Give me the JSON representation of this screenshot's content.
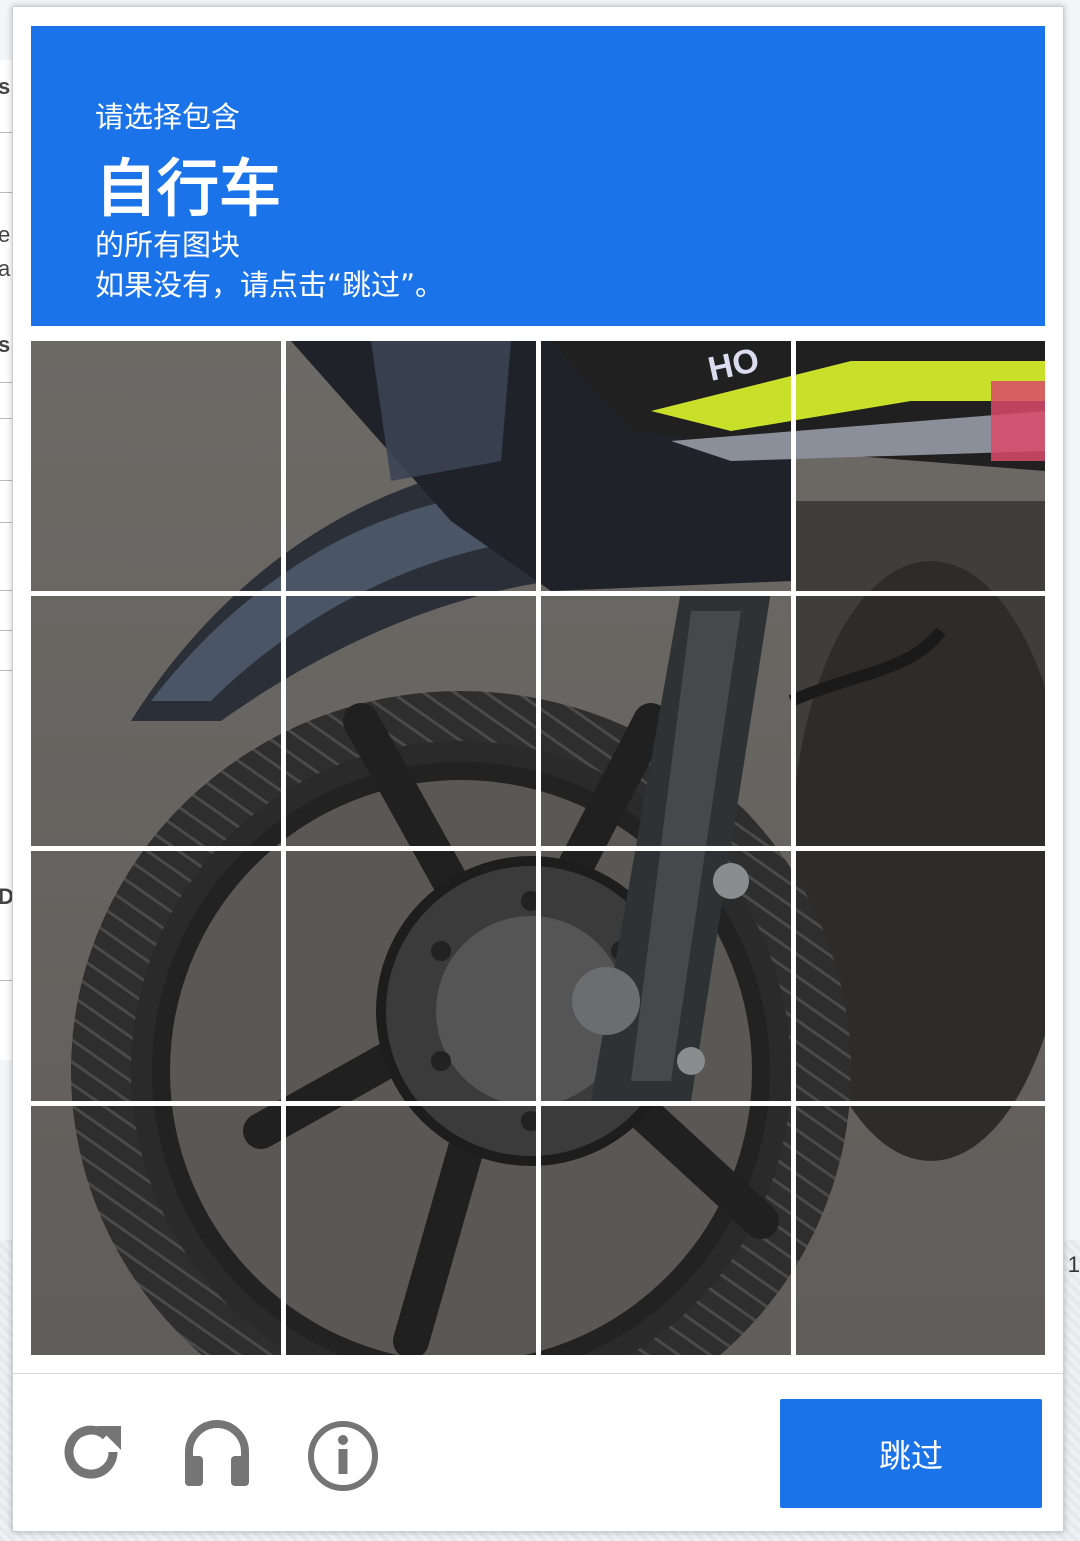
{
  "background": {
    "fragments": [
      "s",
      "e",
      "a",
      "s",
      "D"
    ],
    "right_number": "1"
  },
  "captcha": {
    "instruction_prefix": "请选择包含",
    "target_object": "自行车",
    "instruction_suffix": "的所有图块",
    "skip_hint": "如果没有，请点击“跳过”。",
    "grid": {
      "rows": 4,
      "cols": 4
    },
    "skip_label": "跳过",
    "icons": {
      "reload": "reload-icon",
      "audio": "headphones-icon",
      "info": "info-icon"
    },
    "colors": {
      "accent": "#1a73e8",
      "icon_gray": "#757575"
    }
  }
}
